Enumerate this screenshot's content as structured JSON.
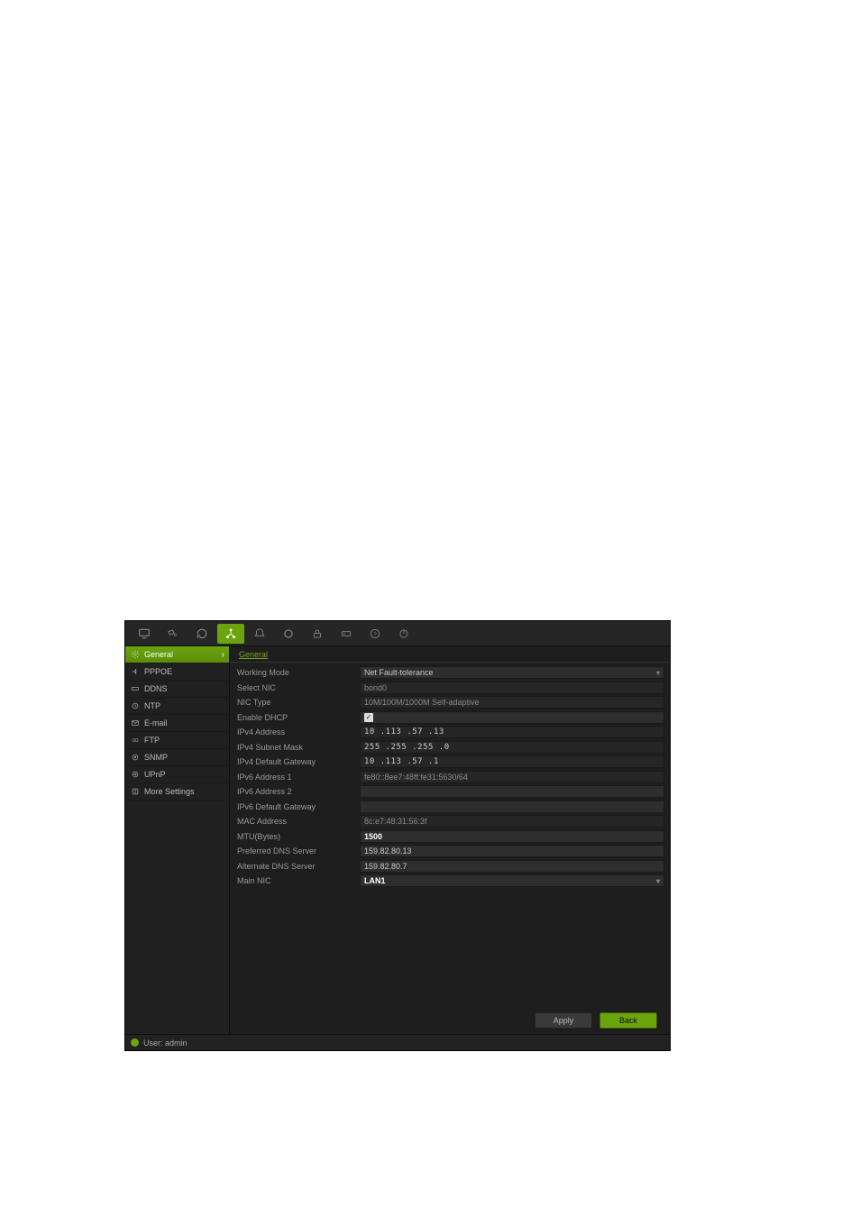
{
  "topbar": {
    "icons": [
      {
        "name": "monitor-icon"
      },
      {
        "name": "camera-icon"
      },
      {
        "name": "refresh-icon"
      },
      {
        "name": "network-icon",
        "active": true
      },
      {
        "name": "alert-icon"
      },
      {
        "name": "record-icon"
      },
      {
        "name": "lock-icon"
      },
      {
        "name": "hdd-icon"
      },
      {
        "name": "help-icon"
      },
      {
        "name": "power-icon"
      }
    ]
  },
  "sidebar": {
    "items": [
      {
        "icon": "gear-icon",
        "label": "General",
        "active": true
      },
      {
        "icon": "pppoe-icon",
        "label": "PPPOE"
      },
      {
        "icon": "ddns-icon",
        "label": "DDNS"
      },
      {
        "icon": "ntp-icon",
        "label": "NTP"
      },
      {
        "icon": "email-icon",
        "label": "E-mail"
      },
      {
        "icon": "ftp-icon",
        "label": "FTP"
      },
      {
        "icon": "snmp-icon",
        "label": "SNMP"
      },
      {
        "icon": "upnp-icon",
        "label": "UPnP"
      },
      {
        "icon": "more-icon",
        "label": "More Settings"
      }
    ]
  },
  "tab": {
    "label": "General"
  },
  "form": {
    "working_mode": {
      "label": "Working Mode",
      "value": "Net Fault-tolerance"
    },
    "select_nic": {
      "label": "Select NIC",
      "value": "bond0"
    },
    "nic_type": {
      "label": "NIC Type",
      "value": "10M/100M/1000M Self-adaptive"
    },
    "enable_dhcp": {
      "label": "Enable DHCP",
      "checked": true
    },
    "ipv4_addr": {
      "label": "IPv4 Address",
      "value": "10  .113 .57  .13"
    },
    "ipv4_mask": {
      "label": "IPv4 Subnet Mask",
      "value": "255 .255 .255 .0"
    },
    "ipv4_gw": {
      "label": "IPv4 Default Gateway",
      "value": "10  .113 .57  .1"
    },
    "ipv6_addr1": {
      "label": "IPv6 Address 1",
      "value": "fe80::8ee7:48ff:fe31:5630/64"
    },
    "ipv6_addr2": {
      "label": "IPv6 Address 2",
      "value": ""
    },
    "ipv6_gw": {
      "label": "IPv6 Default Gateway",
      "value": ""
    },
    "mac": {
      "label": "MAC Address",
      "value": "8c:e7:48:31:56:3f"
    },
    "mtu": {
      "label": "MTU(Bytes)",
      "value": "1500"
    },
    "pref_dns": {
      "label": "Preferred DNS Server",
      "value": "159.82.80.13"
    },
    "alt_dns": {
      "label": "Alternate DNS Server",
      "value": "159.82.80.7"
    },
    "main_nic": {
      "label": "Main NIC",
      "value": "LAN1"
    }
  },
  "buttons": {
    "apply": "Apply",
    "back": "Back"
  },
  "status": {
    "user_label": "User: admin"
  }
}
